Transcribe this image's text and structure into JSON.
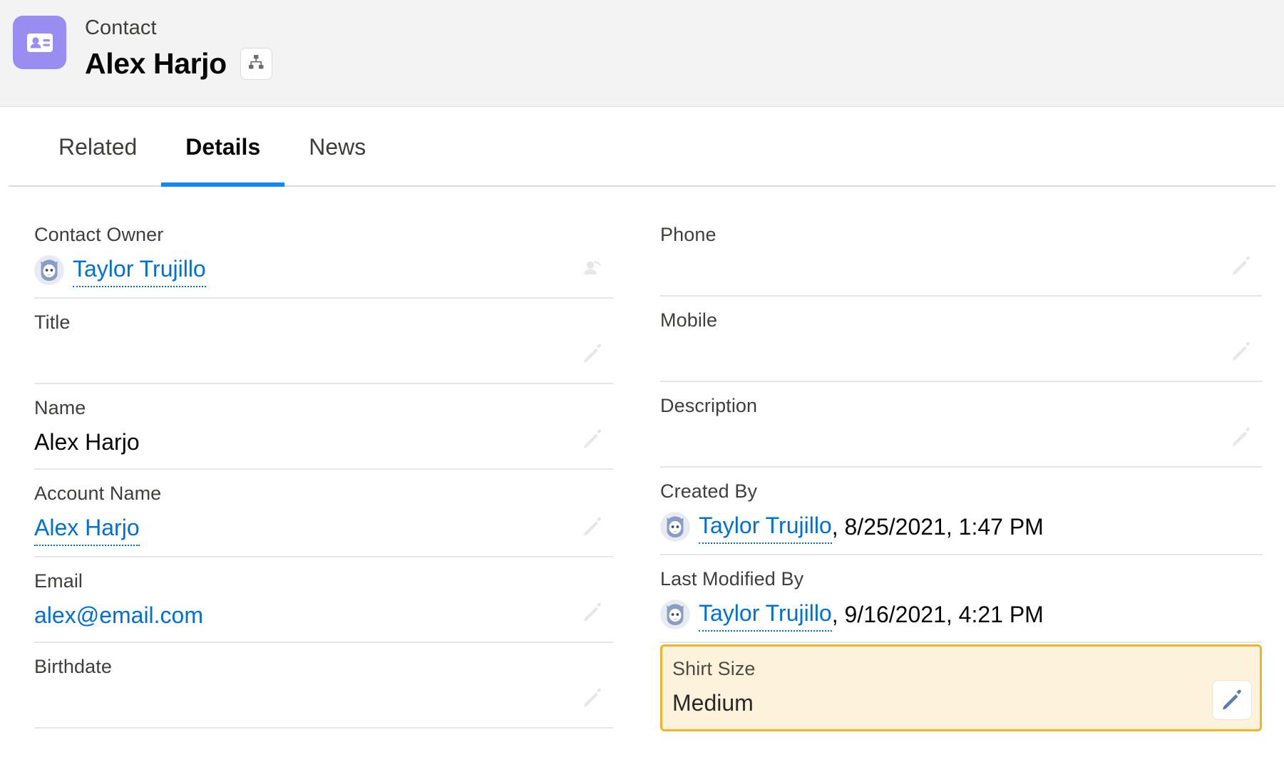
{
  "header": {
    "object_type": "Contact",
    "record_name": "Alex Harjo",
    "record_icon": "contact-card-icon",
    "hierarchy_button_icon": "hierarchy-icon",
    "icon_color": "#9a8df2"
  },
  "tabs": [
    {
      "label": "Related",
      "active": false
    },
    {
      "label": "Details",
      "active": true
    },
    {
      "label": "News",
      "active": false
    }
  ],
  "accent_color": "#1589ee",
  "link_color": "#0070d2",
  "highlight": {
    "border_color": "#f0b429",
    "background_color": "#fdf2dc"
  },
  "left_column": [
    {
      "label": "Contact Owner",
      "value": "Taylor Trujillo",
      "value_type": "user-link",
      "has_avatar": true,
      "action_icon": "change-owner-icon"
    },
    {
      "label": "Title",
      "value": "",
      "value_type": "text",
      "has_avatar": false,
      "action_icon": "pencil-icon"
    },
    {
      "label": "Name",
      "value": "Alex Harjo",
      "value_type": "text",
      "has_avatar": false,
      "action_icon": "pencil-icon"
    },
    {
      "label": "Account Name",
      "value": "Alex Harjo",
      "value_type": "record-link",
      "has_avatar": false,
      "action_icon": "pencil-icon"
    },
    {
      "label": "Email",
      "value": "alex@email.com",
      "value_type": "email-link",
      "has_avatar": false,
      "action_icon": "pencil-icon"
    },
    {
      "label": "Birthdate",
      "value": "",
      "value_type": "text",
      "has_avatar": false,
      "action_icon": "pencil-icon"
    }
  ],
  "right_column": [
    {
      "label": "Phone",
      "value": "",
      "value_type": "text",
      "has_avatar": false,
      "action_icon": "pencil-icon",
      "highlighted": false
    },
    {
      "label": "Mobile",
      "value": "",
      "value_type": "text",
      "has_avatar": false,
      "action_icon": "pencil-icon",
      "highlighted": false
    },
    {
      "label": "Description",
      "value": "",
      "value_type": "text",
      "has_avatar": false,
      "action_icon": "pencil-icon",
      "highlighted": false
    },
    {
      "label": "Created By",
      "value": "Taylor Trujillo",
      "meta": ", 8/25/2021, 1:47 PM",
      "value_type": "user-link-meta",
      "has_avatar": true,
      "action_icon": "",
      "highlighted": false
    },
    {
      "label": "Last Modified By",
      "value": "Taylor Trujillo",
      "meta": ", 9/16/2021, 4:21 PM",
      "value_type": "user-link-meta",
      "has_avatar": true,
      "action_icon": "",
      "highlighted": false
    },
    {
      "label": "Shirt Size",
      "value": "Medium",
      "value_type": "text",
      "has_avatar": false,
      "action_icon": "pencil-icon-active",
      "highlighted": true
    }
  ]
}
